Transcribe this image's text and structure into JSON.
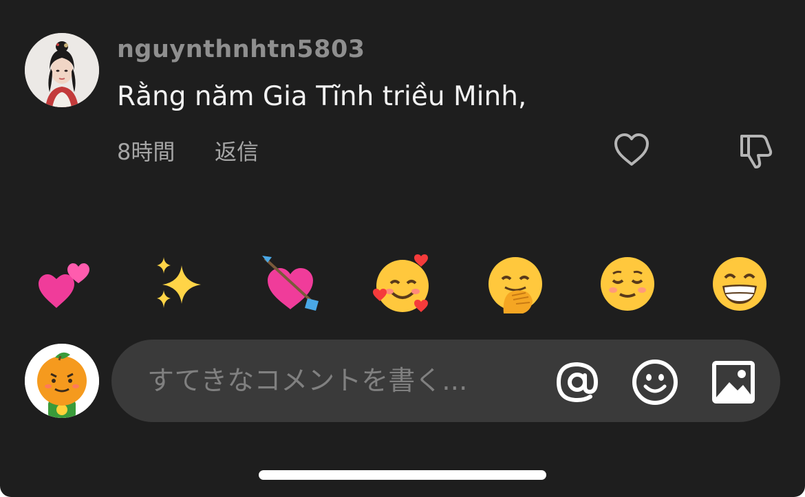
{
  "comment": {
    "username": "nguynthnhtn5803",
    "text": "Rằng năm Gia Tĩnh triều Minh,",
    "time": "8時間",
    "reply_label": "返信",
    "avatar_icon": "user-avatar-photo",
    "like_icon": "heart-outline-icon",
    "dislike_icon": "thumbs-down-outline-icon"
  },
  "quick_emojis": [
    {
      "name": "two-hearts-emoji"
    },
    {
      "name": "sparkles-emoji"
    },
    {
      "name": "heart-with-arrow-emoji"
    },
    {
      "name": "smiling-face-with-hearts-emoji"
    },
    {
      "name": "face-with-hand-over-mouth-emoji"
    },
    {
      "name": "relieved-face-emoji"
    },
    {
      "name": "beaming-face-emoji"
    }
  ],
  "composer": {
    "placeholder": "すてきなコメントを書く...",
    "value": "",
    "my_avatar_icon": "orange-mascot-avatar",
    "mention_icon": "at-sign-icon",
    "emoji_icon": "smiley-face-icon",
    "image_icon": "image-icon"
  },
  "colors": {
    "background": "#1e1e1e",
    "input_background": "#3a3a3a",
    "username": "#8f8f8f",
    "text": "#f2f2f2",
    "meta": "#a6a6a6"
  }
}
